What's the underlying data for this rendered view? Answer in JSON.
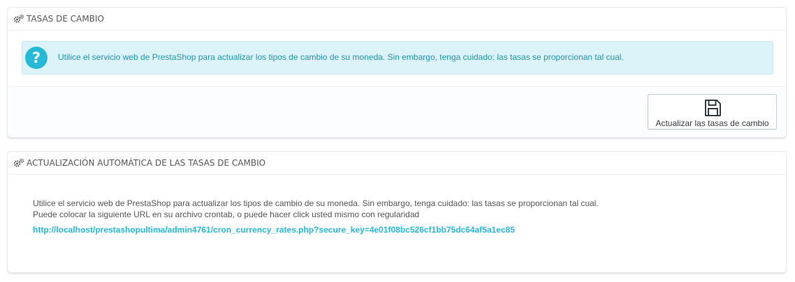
{
  "panel_rates": {
    "title": "TASAS DE CAMBIO",
    "title_icon": "gears-icon",
    "info_icon": "question-icon",
    "info_icon_glyph": "?",
    "info_text": "Utilice el servicio web de PrestaShop para actualizar los tipos de cambio de su moneda. Sin embargo, tenga cuidado: las tasas se proporcionan tal cual.",
    "update_button_icon": "save-icon",
    "update_button_label": "Actualizar las tasas de cambio"
  },
  "panel_auto": {
    "title": "ACTUALIZACIÓN AUTOMÁTICA DE LAS TASAS DE CAMBIO",
    "title_icon": "gears-icon",
    "line1": "Utilice el servicio web de PrestaShop para actualizar los tipos de cambio de su moneda. Sin embargo, tenga cuidado: las tasas se proporcionan tal cual.",
    "line2": "Puede colocar la siguiente URL en su archivo crontab, o puede hacer click usted mismo con regularidad",
    "cron_url": "http://localhost/prestashopultima/admin4761/cron_currency_rates.php?secure_key=4e01f08bc526cf1bb75dc64af5a1ec85"
  },
  "colors": {
    "accent": "#25b9d7",
    "info_bg": "#dcf4f9",
    "info_text": "#1e94ab",
    "text": "#555555"
  }
}
